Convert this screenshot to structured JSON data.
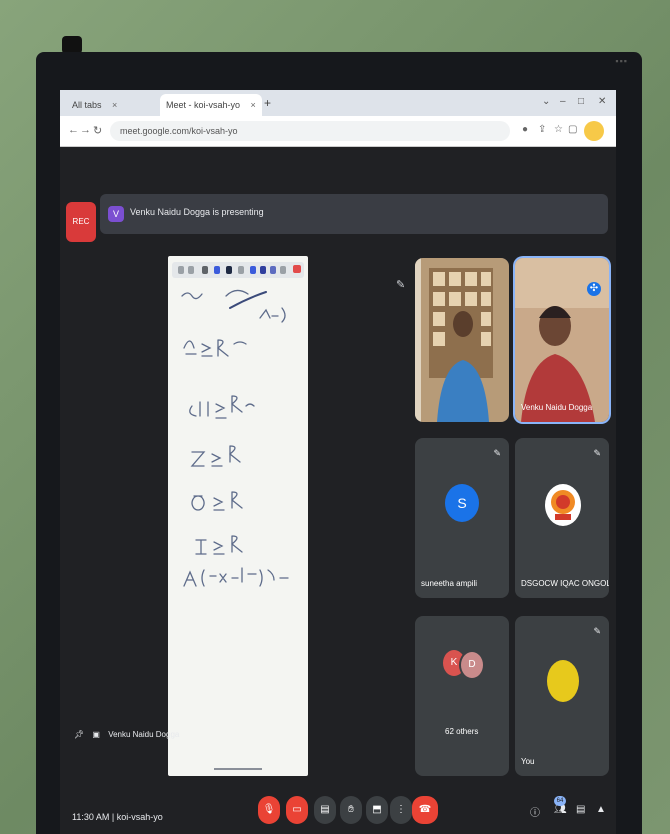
{
  "browser": {
    "tab1": "All tabs",
    "tab2": "Meet - koi-vsah-yo",
    "new_tab": "+",
    "url": "meet.google.com/koi-vsah-yo"
  },
  "meet": {
    "rec": "REC",
    "presenter_initial": "V",
    "presenting_text": "Venku Naidu Dogga is presenting",
    "presenter_footer": "Venku Naidu Dogga",
    "tiles": [
      {
        "name": ""
      },
      {
        "name": "Venku Naidu Dogga"
      },
      {
        "name": "suneetha ampili",
        "initial": "S"
      },
      {
        "name": "DSGOCW IQAC ONGOLE"
      },
      {
        "name": "62 others",
        "initials": [
          "K",
          "D"
        ]
      },
      {
        "name": "You"
      }
    ],
    "time": "11:30 AM",
    "meeting_code": "koi-vsah-yo"
  },
  "colors": {
    "meet_bg": "#202124",
    "tile_bg": "#3c4043",
    "hangup": "#ea4335",
    "accent": "#1a73e8"
  }
}
